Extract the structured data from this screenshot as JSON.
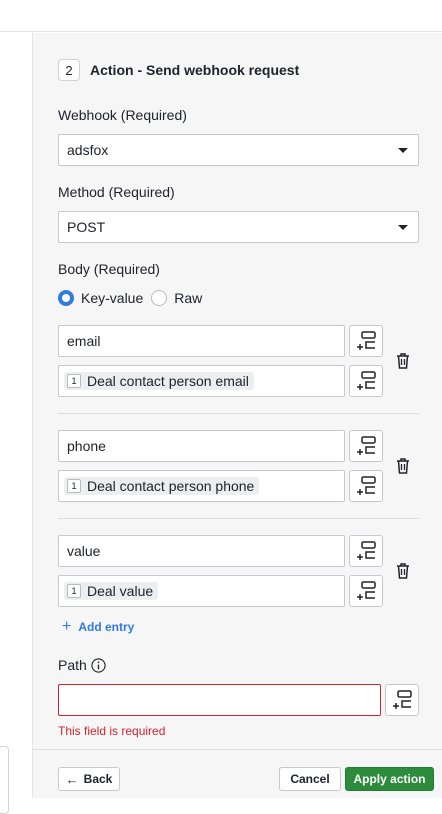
{
  "step": {
    "number": "2",
    "title": "Action - Send webhook request"
  },
  "webhook": {
    "label": "Webhook (Required)",
    "value": "adsfox"
  },
  "method": {
    "label": "Method (Required)",
    "value": "POST"
  },
  "body": {
    "label": "Body (Required)",
    "options": [
      "Key-value",
      "Raw"
    ],
    "selected": "Key-value"
  },
  "entries": [
    {
      "key": "email",
      "chip_num": "1",
      "value": "Deal contact person email"
    },
    {
      "key": "phone",
      "chip_num": "1",
      "value": "Deal contact person phone"
    },
    {
      "key": "value",
      "chip_num": "1",
      "value": "Deal value"
    }
  ],
  "add_entry_label": "Add entry",
  "path": {
    "label": "Path",
    "value": "",
    "error": "This field is required"
  },
  "footer": {
    "back_label": "Back",
    "cancel_label": "Cancel",
    "apply_label": "Apply action"
  },
  "colors": {
    "accent": "#317ae2",
    "apply": "#2d8c3c",
    "error": "#d0242d"
  },
  "icons": {
    "insert": "insert-field-icon",
    "delete": "trash-icon",
    "info": "info-icon",
    "dropdown": "caret-down-icon",
    "back": "arrow-left-icon",
    "add": "plus-icon"
  }
}
